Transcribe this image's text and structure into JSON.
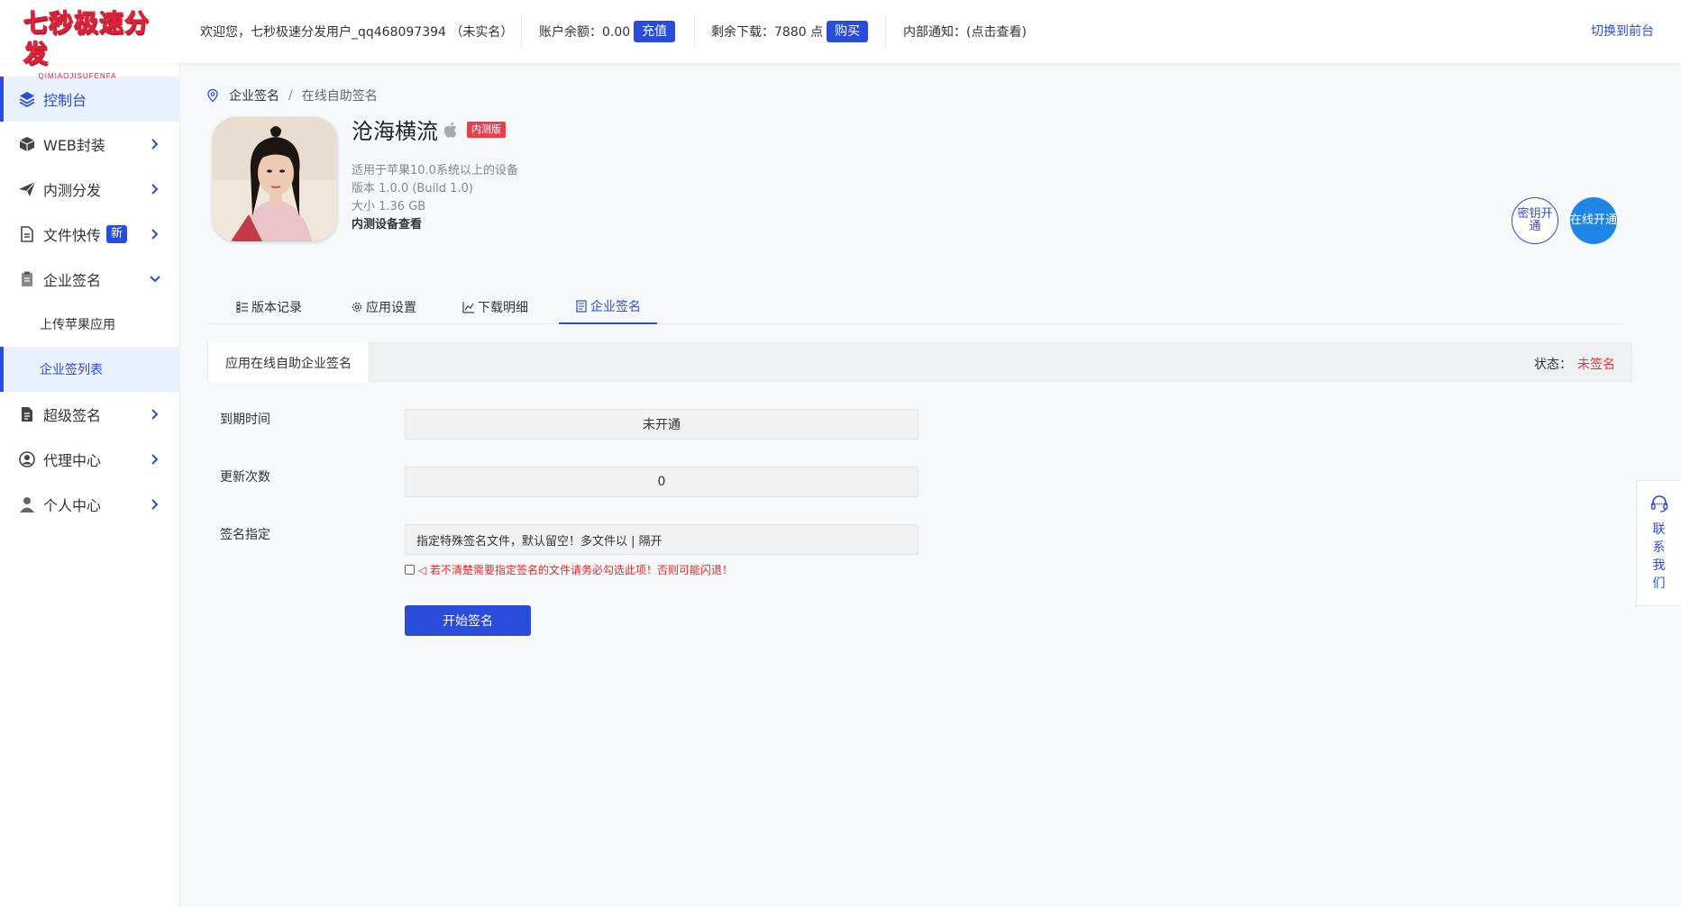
{
  "header": {
    "logo_text": "七秒极速分发",
    "logo_sub": "QIMIAOJISUFENFA",
    "welcome": "欢迎您，七秒极速分发用户_qq468097394 （未实名）",
    "balance_label": "账户余额：0.00",
    "recharge_label": "充值",
    "downloads_label": "剩余下载：7880 点",
    "buy_label": "购买",
    "notice_label": "内部通知：(点击查看)",
    "switch_label": "切换到前台"
  },
  "sidebar": {
    "items": [
      {
        "label": "控制台",
        "icon": "layers-icon"
      },
      {
        "label": "WEB封装",
        "icon": "cube-icon"
      },
      {
        "label": "内测分发",
        "icon": "paper-plane-icon"
      },
      {
        "label": "文件快传",
        "icon": "file-icon",
        "badge": "新"
      },
      {
        "label": "企业签名",
        "icon": "clipboard-icon"
      },
      {
        "label": "超级签名",
        "icon": "document-icon"
      },
      {
        "label": "代理中心",
        "icon": "agent-icon"
      },
      {
        "label": "个人中心",
        "icon": "user-icon"
      }
    ],
    "sub_items": [
      {
        "label": "上传苹果应用"
      },
      {
        "label": "企业签列表"
      }
    ]
  },
  "breadcrumb": {
    "root": "企业签名",
    "separator": "/",
    "current": "在线自助签名"
  },
  "app": {
    "name": "沧海横流",
    "badge": "内测版",
    "compat": "适用于苹果10.0系统以上的设备",
    "version": "版本   1.0.0 (Build 1.0)",
    "size": "大小   1.36 GB",
    "devices_link": "内测设备查看"
  },
  "actions": {
    "key_open": "密钥开通",
    "online_open": "在线开通"
  },
  "tabs": [
    {
      "label": "版本记录"
    },
    {
      "label": "应用设置"
    },
    {
      "label": "下载明细"
    },
    {
      "label": "企业签名"
    }
  ],
  "panel": {
    "tab_label": "应用在线自助企业签名",
    "status_label": "状态：",
    "status_value": "未签名"
  },
  "form": {
    "expiry_label": "到期时间",
    "expiry_value": "未开通",
    "updates_label": "更新次数",
    "updates_value": "0",
    "assign_label": "签名指定",
    "assign_placeholder": "指定特殊签名文件，默认留空！多文件以 | 隔开",
    "warning": "◁ 若不清楚需要指定签名的文件请务必勾选此项！否则可能闪退！",
    "start_button": "开始签名"
  },
  "contact": {
    "label": "联系我们"
  },
  "colors": {
    "accent": "#2a4cdb",
    "danger": "#e33",
    "online_btn": "#1f86e8"
  }
}
